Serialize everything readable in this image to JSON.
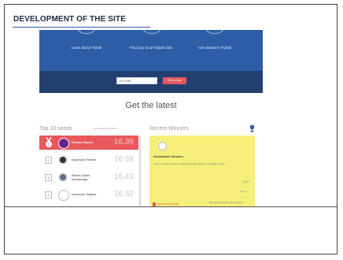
{
  "slide": {
    "title": "DEVELOPMENT OF THE SITE"
  },
  "banner": {
    "nav": [
      {
        "label": "Learn about Flyball"
      },
      {
        "label": "Find your local Flyball Club"
      },
      {
        "label": "Get started in Flyball"
      }
    ],
    "search_value": "PO1 6NE",
    "find_button": "Find a Club"
  },
  "headline": "Get the latest",
  "seeds": {
    "heading": "Top 10 seeds",
    "updated": "Last updated: 28/10/2016",
    "rows": [
      {
        "rank": "1",
        "name": "Extreme Racers",
        "time": "16.39"
      },
      {
        "rank": "2",
        "name": "Supersonic Sixfives",
        "time": "16.39"
      },
      {
        "rank": "3",
        "name": "Wolves Online Wonderdogs",
        "time": "16.43"
      },
      {
        "rank": "4",
        "name": "Knebworth Twisters",
        "time": "16.52"
      }
    ]
  },
  "winners": {
    "heading": "Recent Winners",
    "team": "Knebworth Twisters",
    "description": "Sports Complex Adams in Ditchling Road, Brighton, Hellingly at 4pm",
    "time": "16.52",
    "share": "Share →",
    "upcoming": "Upcoming Events",
    "footer_right": "BFA 2016 Sunday, 20 Nov 2016"
  },
  "colors": {
    "brand_blue": "#2e5da8",
    "band_dark": "#233f70",
    "accent_red": "#e8585c",
    "card_yellow": "#f6ef7a"
  }
}
